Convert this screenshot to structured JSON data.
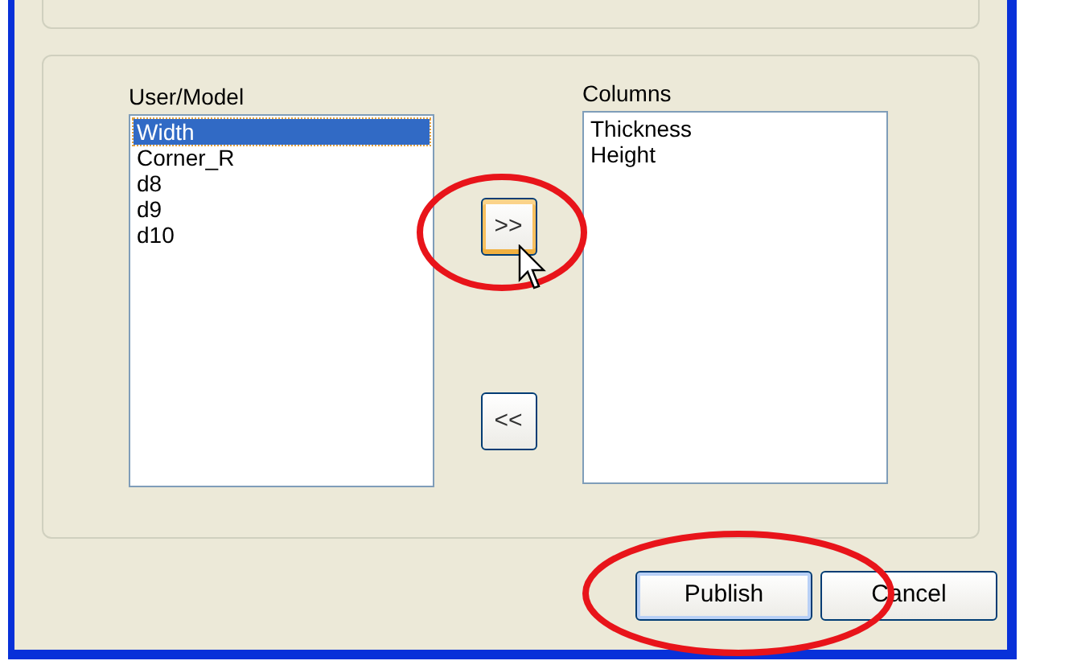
{
  "available": {
    "label": "User/Model",
    "items": [
      {
        "text": "Width",
        "selected": true
      },
      {
        "text": "Corner_R",
        "selected": false
      },
      {
        "text": "d8",
        "selected": false
      },
      {
        "text": "d9",
        "selected": false
      },
      {
        "text": "d10",
        "selected": false
      }
    ]
  },
  "move_buttons": [
    {
      "label": ">>",
      "focused": true
    },
    {
      "label": "<<",
      "focused": false
    }
  ],
  "columns": {
    "label": "Columns",
    "items": [
      {
        "text": "Thickness",
        "selected": false
      },
      {
        "text": "Height",
        "selected": false
      }
    ]
  },
  "buttons": [
    {
      "label": "Publish",
      "default": true
    },
    {
      "label": "Cancel",
      "default": false
    }
  ]
}
